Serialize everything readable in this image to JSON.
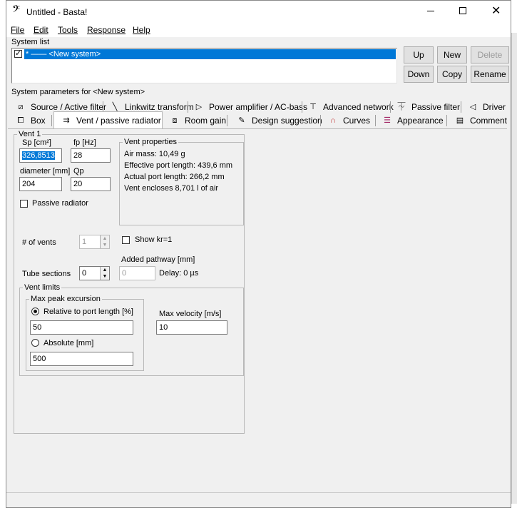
{
  "window": {
    "title": "Untitled - Basta!"
  },
  "menu": [
    "File",
    "Edit",
    "Tools",
    "Response",
    "Help"
  ],
  "system_list": {
    "label": "System list",
    "item": "* —— <New system>",
    "buttons": {
      "up": "Up",
      "new": "New",
      "delete": "Delete",
      "down": "Down",
      "copy": "Copy",
      "rename": "Rename"
    }
  },
  "params_label": "System parameters for <New system>",
  "tabs_row1": [
    "Source / Active filter",
    "Linkwitz transform",
    "Power amplifier / AC-bass",
    "Advanced network",
    "Passive filter",
    "Driver"
  ],
  "tabs_row2": [
    "Box",
    "Vent / passive radiator",
    "Room gain",
    "Design suggestion",
    "Curves",
    "Appearance",
    "Comment"
  ],
  "vent": {
    "group_title": "Vent 1",
    "sp_label": "Sp [cm²]",
    "sp_value": "326,8513",
    "fp_label": "fp [Hz]",
    "fp_value": "28",
    "diameter_label": "diameter [mm]",
    "diameter_value": "204",
    "qp_label": "Qp",
    "qp_value": "20",
    "passive_radiator_label": "Passive radiator",
    "properties": {
      "title": "Vent properties",
      "air_mass": "Air mass: 10,49 g",
      "effective_length": "Effective port length: 439,6 mm",
      "actual_length": "Actual port length: 266,2 mm",
      "encloses": "Vent encloses 8,701 l of air"
    },
    "num_vents_label": "# of vents",
    "num_vents_value": "1",
    "show_kr_label": "Show kr=1",
    "added_pathway_label": "Added pathway [mm]",
    "added_pathway_value": "0",
    "delay_label": "Delay: 0 µs",
    "tube_sections_label": "Tube sections",
    "tube_sections_value": "0",
    "limits": {
      "title": "Vent limits",
      "max_peak_title": "Max peak excursion",
      "relative_label": "Relative to port length [%]",
      "relative_value": "50",
      "absolute_label": "Absolute [mm]",
      "absolute_value": "500",
      "max_velocity_label": "Max velocity [m/s]",
      "max_velocity_value": "10"
    }
  }
}
